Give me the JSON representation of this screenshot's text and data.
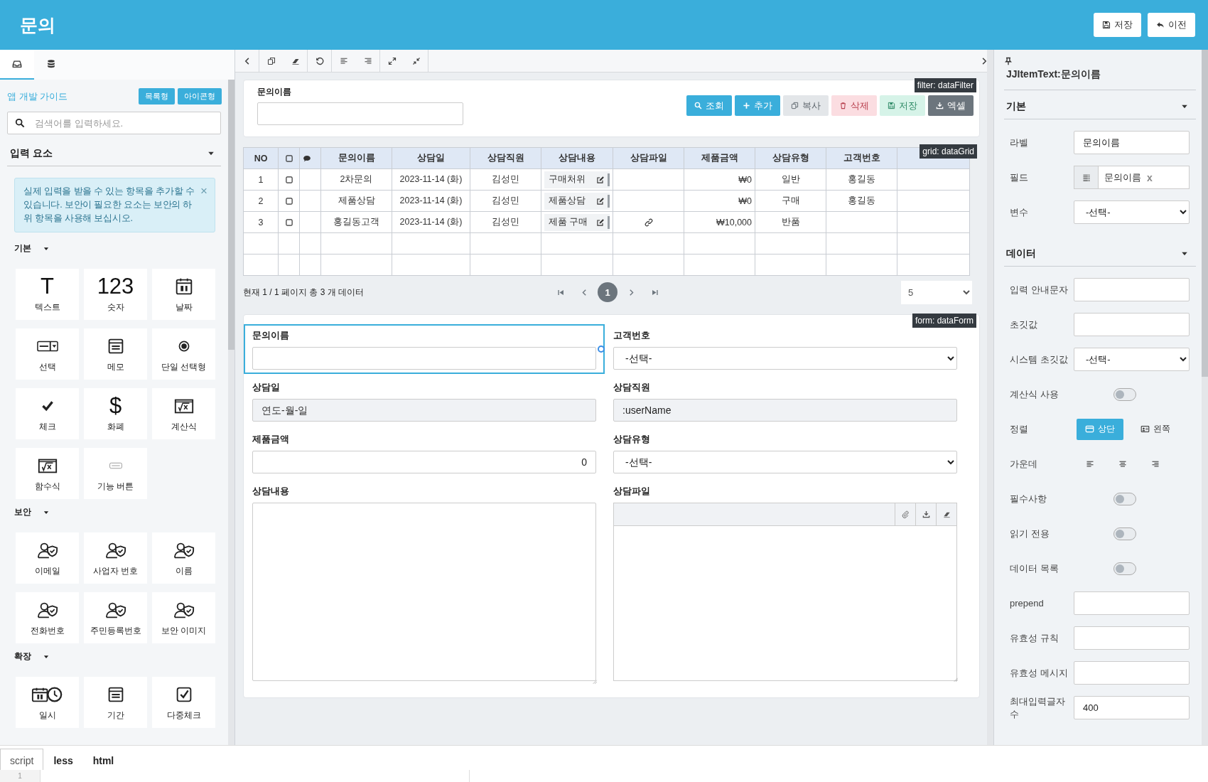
{
  "header": {
    "title": "문의",
    "buttons": [
      {
        "label": "저장",
        "kind": "save"
      },
      {
        "label": "이전",
        "kind": "back"
      }
    ]
  },
  "sidebar": {
    "tabs": [
      {
        "selected": true
      },
      {
        "selected": false
      }
    ],
    "guide_link": "앱 개발 가이드",
    "view_buttons": [
      "목록형",
      "아이콘형"
    ],
    "search": {
      "placeholder": "검색어를 입력하세요."
    },
    "section_title": "입력 요소",
    "alert": {
      "text": "실제 입력을 받을 수 있는 항목을 추가할 수 있습니다. 보안이 필요한 요소는 보안의 하위 항목을 사용해 보십시오.",
      "close": "×"
    },
    "groups": [
      {
        "title": "기본",
        "items": [
          {
            "label": "텍스트",
            "kind": "glyph",
            "glyph": "T"
          },
          {
            "label": "숫자",
            "kind": "glyph",
            "glyph": "123"
          },
          {
            "label": "날짜",
            "kind": "date"
          },
          {
            "label": "선택",
            "kind": "select"
          },
          {
            "label": "메모",
            "kind": "memo"
          },
          {
            "label": "단일 선택형",
            "kind": "radio"
          },
          {
            "label": "체크",
            "kind": "check"
          },
          {
            "label": "화폐",
            "kind": "glyph",
            "glyph": "$"
          },
          {
            "label": "계산식",
            "kind": "formula"
          },
          {
            "label": "함수식",
            "kind": "formula"
          },
          {
            "label": "기능 버튼",
            "kind": "button"
          }
        ]
      },
      {
        "title": "보안",
        "items": [
          {
            "label": "이메일",
            "kind": "secure"
          },
          {
            "label": "사업자 번호",
            "kind": "secure"
          },
          {
            "label": "이름",
            "kind": "secure"
          },
          {
            "label": "전화번호",
            "kind": "secure"
          },
          {
            "label": "주민등록번호",
            "kind": "secure"
          },
          {
            "label": "보안 이미지",
            "kind": "secure"
          }
        ]
      },
      {
        "title": "확장",
        "items": [
          {
            "label": "일시",
            "kind": "datetime"
          },
          {
            "label": "기간",
            "kind": "memo"
          },
          {
            "label": "다중체크",
            "kind": "multicheck"
          }
        ]
      }
    ]
  },
  "filter": {
    "badge": "filter: dataFilter",
    "fields": [
      {
        "label": "문의이름"
      }
    ],
    "buttons": [
      {
        "label": "조회",
        "kind": "search",
        "disabled": false
      },
      {
        "label": "추가",
        "kind": "add",
        "disabled": false
      },
      {
        "label": "복사",
        "kind": "copy",
        "disabled": true
      },
      {
        "label": "삭제",
        "kind": "delete",
        "disabled": true
      },
      {
        "label": "저장",
        "kind": "save",
        "disabled": true
      },
      {
        "label": "엑셀",
        "kind": "excel",
        "disabled": false
      }
    ]
  },
  "grid": {
    "badge": "grid: dataGrid",
    "columns": [
      {
        "label": "NO"
      },
      {
        "kind": "checkbox",
        "checked": false
      },
      {
        "kind": "comment"
      },
      {
        "label": "문의이름"
      },
      {
        "label": "상담일"
      },
      {
        "label": "상담직원"
      },
      {
        "label": "상담내용"
      },
      {
        "label": "상담파일"
      },
      {
        "label": "제품금액"
      },
      {
        "label": "상담유형"
      },
      {
        "label": "고객번호"
      }
    ],
    "rows": [
      {
        "no": "1",
        "checked": false,
        "name": "2차문의",
        "date": "2023-11-14 (화)",
        "staff": "김성민",
        "content": "구매처위",
        "attachment": false,
        "amount": "₩0",
        "type": "일반",
        "customer": "홍길동"
      },
      {
        "no": "2",
        "checked": false,
        "name": "제품상담",
        "date": "2023-11-14 (화)",
        "staff": "김성민",
        "content": "제품상담",
        "attachment": false,
        "amount": "₩0",
        "type": "구매",
        "customer": "홍길동"
      },
      {
        "no": "3",
        "checked": false,
        "name": "홍길동고객",
        "date": "2023-11-14 (화)",
        "staff": "김성민",
        "content": "제품 구매",
        "attachment": true,
        "amount": "₩10,000",
        "type": "반품"
      }
    ],
    "pagination": {
      "summary": "현재 1 / 1 페이지 총 3 개 데이터",
      "pages": [
        {
          "label": "1",
          "selected": true
        }
      ],
      "page_size": "5"
    }
  },
  "form": {
    "badge": "form: dataForm",
    "fields": [
      {
        "label": "문의이름",
        "kind": "text",
        "selected": true,
        "readonly": false
      },
      {
        "label": "고객번호",
        "kind": "select",
        "value": "-선택-",
        "selected": false,
        "readonly": false
      },
      {
        "label": "상담일",
        "kind": "text",
        "placeholder": "연도-월-일",
        "selected": false,
        "readonly": true
      },
      {
        "label": "상담직원",
        "kind": "text",
        "value": ":userName",
        "selected": false,
        "readonly": true
      },
      {
        "label": "제품금액",
        "kind": "number",
        "value": "0",
        "selected": false,
        "readonly": false
      },
      {
        "label": "상담유형",
        "kind": "select",
        "value": "-선택-",
        "selected": false,
        "readonly": false
      },
      {
        "label": "상담내용",
        "kind": "textarea",
        "selected": false,
        "readonly": false
      },
      {
        "label": "상담파일",
        "kind": "file",
        "selected": false,
        "readonly": false
      }
    ]
  },
  "properties": {
    "title": "JJItemText:문의이름",
    "sections": [
      {
        "title": "기본",
        "rows": [
          {
            "label": "라벨",
            "kind": "input",
            "value": "문의이름"
          },
          {
            "label": "필드",
            "kind": "field",
            "value": "문의이름",
            "clear": "x"
          },
          {
            "label": "변수",
            "kind": "select",
            "value": "-선택-"
          }
        ]
      },
      {
        "title": "데이터",
        "rows": [
          {
            "label": "입력 안내문자",
            "kind": "input"
          },
          {
            "label": "초깃값",
            "kind": "input"
          },
          {
            "label": "시스템 초깃값",
            "kind": "select",
            "value": "-선택-"
          },
          {
            "label": "계산식 사용",
            "kind": "toggle",
            "on": false
          },
          {
            "label": "정렬",
            "kind": "segment",
            "options": [
              {
                "label": "상단",
                "selected": true
              },
              {
                "label": "왼쪽",
                "selected": false
              }
            ]
          },
          {
            "label": "가운데",
            "kind": "align"
          },
          {
            "label": "필수사항",
            "kind": "toggle",
            "on": false
          },
          {
            "label": "읽기 전용",
            "kind": "toggle",
            "on": false
          },
          {
            "label": "데이터 목록",
            "kind": "toggle",
            "on": false
          },
          {
            "label": "prepend",
            "kind": "input"
          },
          {
            "label": "유효성 규칙",
            "kind": "input"
          },
          {
            "label": "유효성 메시지",
            "kind": "input"
          },
          {
            "label": "최대입력글자수",
            "kind": "input",
            "value": "400"
          }
        ]
      }
    ]
  },
  "code_tabs": [
    {
      "label": "script",
      "selected": true
    },
    {
      "label": "less",
      "selected": false
    },
    {
      "label": "html",
      "selected": false
    }
  ],
  "editor": {
    "line_numbers": [
      "1"
    ]
  }
}
